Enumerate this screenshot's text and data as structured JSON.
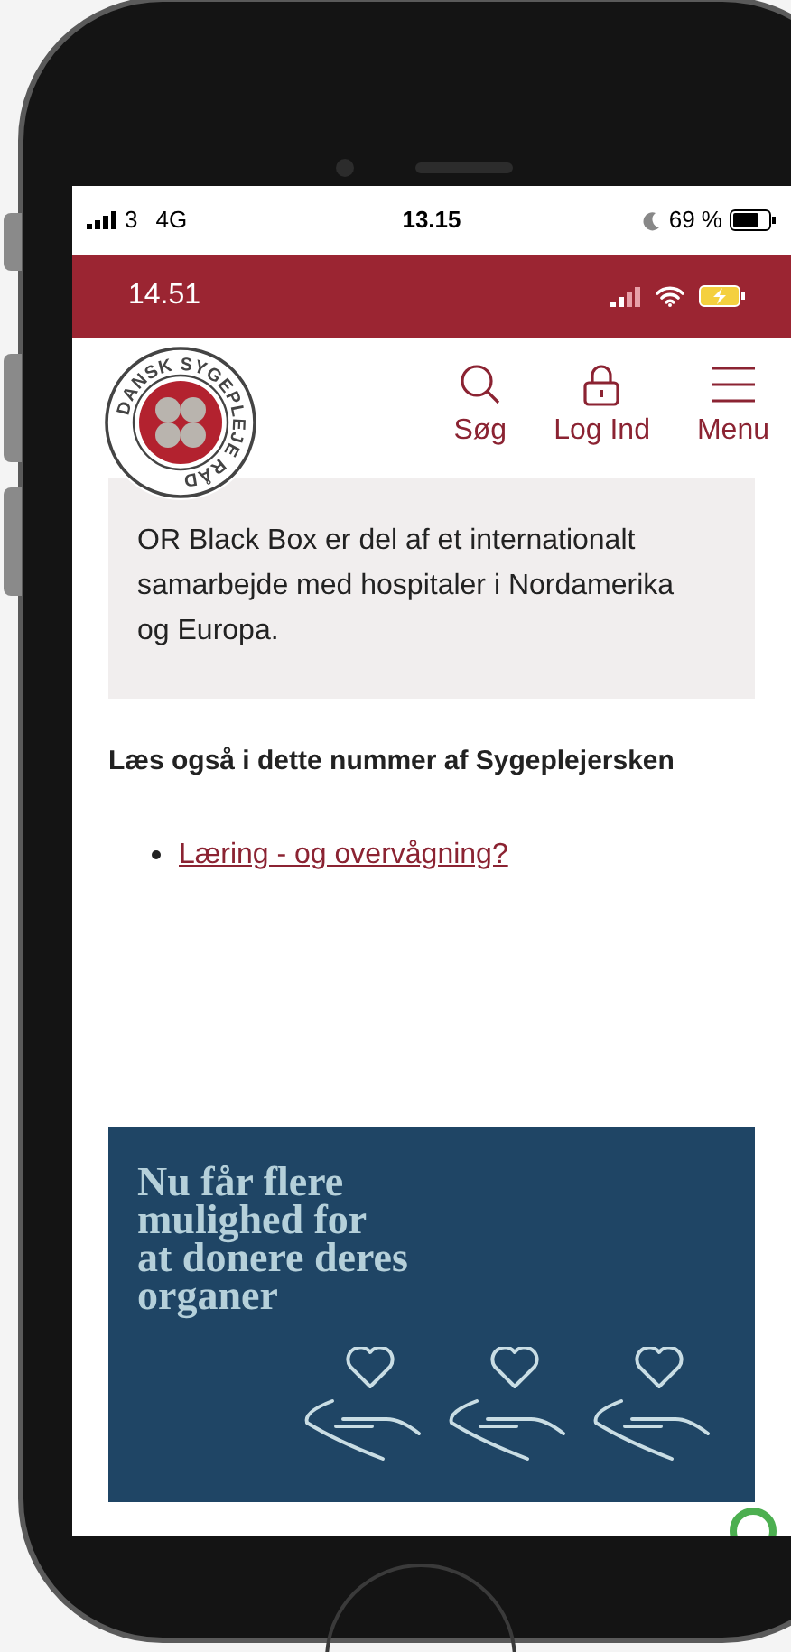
{
  "outer_status_bar": {
    "carrier": "3",
    "network": "4G",
    "time": "13.15",
    "battery": "69 %"
  },
  "inner_status_bar": {
    "time": "14.51"
  },
  "header": {
    "logo_text": "DANSK SYGEPLEJE RÅD",
    "nav": [
      {
        "label": "Søg",
        "kind": "search"
      },
      {
        "label": "Log Ind",
        "kind": "lock"
      },
      {
        "label": "Menu",
        "kind": "menu"
      }
    ]
  },
  "info_box": {
    "text": "OR Black Box er del af et internationalt samarbejde med hospitaler i Nordamerika og Europa."
  },
  "related": {
    "heading": "Læs også i dette nummer af Sygeplejersken",
    "links": [
      "Læring - og overvågning?"
    ]
  },
  "banner": {
    "headline": "Nu får flere\nmulighed for\nat donere deres\norganer"
  }
}
